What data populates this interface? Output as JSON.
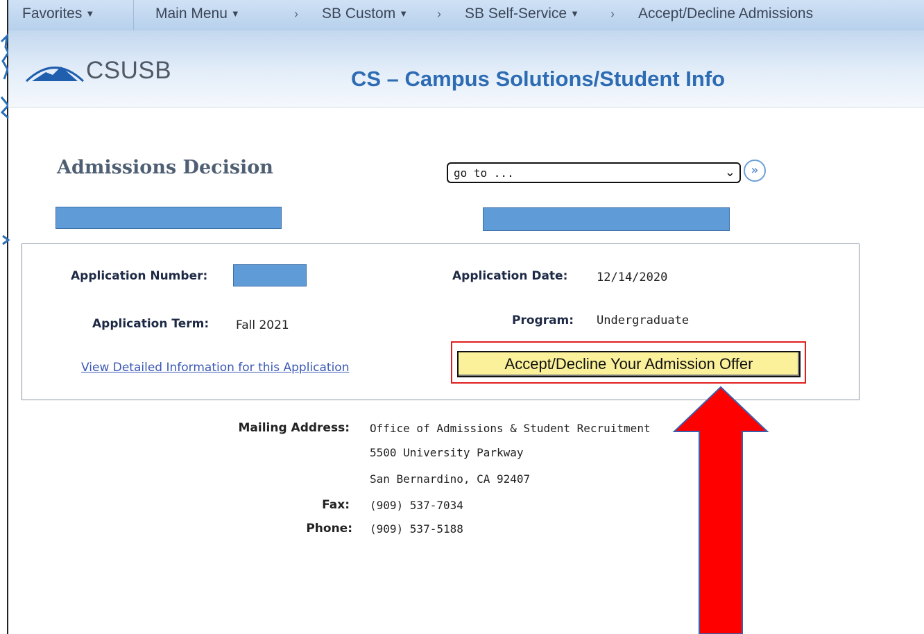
{
  "nav": {
    "favorites": "Favorites",
    "main_menu": "Main Menu",
    "crumbs": [
      "SB Custom",
      "SB Self-Service",
      "Accept/Decline Admissions"
    ]
  },
  "header": {
    "logo_text": "CSUSB",
    "title": "CS – Campus Solutions/Student Info"
  },
  "page": {
    "title": "Admissions Decision",
    "goto": {
      "selected": "go to ..."
    }
  },
  "application": {
    "number_label": "Application Number:",
    "date_label": "Application Date:",
    "date_value": "12/14/2020",
    "term_label": "Application Term:",
    "term_value": "Fall 2021",
    "program_label": "Program:",
    "program_value": "Undergraduate",
    "detail_link": "View Detailed Information for this Application",
    "accept_button": "Accept/Decline Your Admission Offer"
  },
  "contact": {
    "mailing_label": "Mailing Address:",
    "mailing_lines": [
      "Office of Admissions & Student Recruitment",
      "5500 University Parkway",
      "San Bernardino, CA 92407"
    ],
    "fax_label": "Fax:",
    "fax_value": "(909) 537-7034",
    "phone_label": "Phone:",
    "phone_value": "(909) 537-5188"
  },
  "colors": {
    "accent": "#2d6bb3",
    "highlight_border": "#e11e1e",
    "annotation_arrow": "#ff0000",
    "button_bg": "#fbf19a",
    "redaction": "#5f9bd7"
  }
}
